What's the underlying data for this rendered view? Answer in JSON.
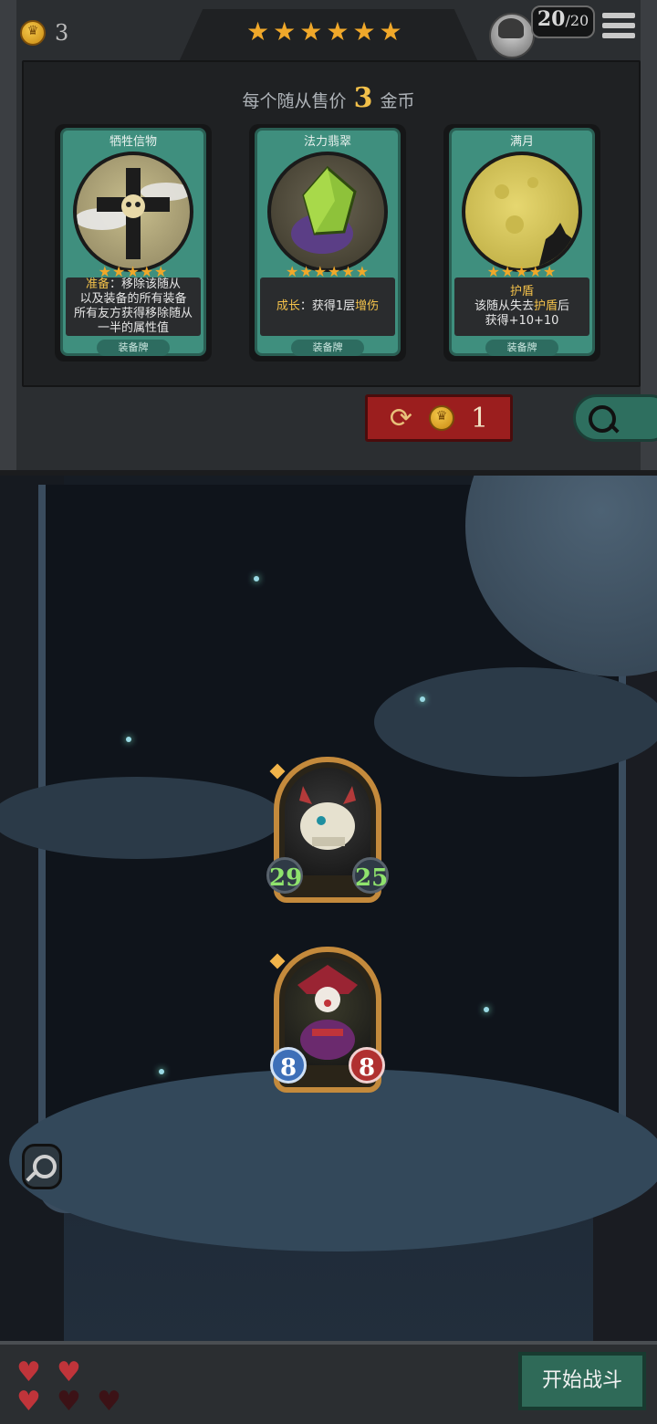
{
  "top_bar": {
    "gold": "3",
    "shop_star_count": 6,
    "shop_star_glyph": "★",
    "population_current": "20",
    "population_separator": "/",
    "population_max": "20",
    "menu_icon": "hamburger-menu-icon",
    "avatar_icon": "player-avatar-icon"
  },
  "shop": {
    "price_prefix": "每个随从售价",
    "price_value": "3",
    "price_suffix": "金币",
    "cards": [
      {
        "name": "牺牲信物",
        "stars": "★★★★★",
        "desc_keyword": "准备",
        "desc_lines": [
          "：移除该随从",
          "以及装备的所有装备",
          "所有友方获得移除随从",
          "一半的属性值"
        ],
        "tag": "装备牌",
        "art_icon": "skull-cross-icon"
      },
      {
        "name": "法力翡翠",
        "stars": "★★★★★★",
        "desc_keyword": "成长",
        "desc_mid": "：获得1层",
        "desc_highlight": "增伤",
        "tag": "装备牌",
        "art_icon": "green-crystal-icon"
      },
      {
        "name": "满月",
        "stars": "★★★★★",
        "desc_title": "护盾",
        "desc_line2_pre": "该随从失去",
        "desc_line2_hl": "护盾",
        "desc_line2_post": "后",
        "desc_line3": "获得+10+10",
        "tag": "装备牌",
        "art_icon": "full-moon-wolf-icon"
      }
    ],
    "refresh_cost": "1",
    "refresh_icon": "refresh-icon",
    "search_icon": "search-icon"
  },
  "board": {
    "units": [
      {
        "name_icon": "bone-dragon-portrait-icon",
        "attack": "29",
        "health": "25",
        "stat_color": "#8fe36d"
      },
      {
        "name_icon": "jester-clown-portrait-icon",
        "attack": "8",
        "health": "8"
      }
    ],
    "inspect_icon": "search-icon"
  },
  "bottom": {
    "lives_full": 3,
    "lives_total": 5,
    "start_battle_label": "开始战斗"
  },
  "colors": {
    "gold_accent": "#f3c14a",
    "card_frame": "#3f8f7e",
    "refresh_button": "#9b1e1e",
    "start_button": "#2f6a58"
  }
}
